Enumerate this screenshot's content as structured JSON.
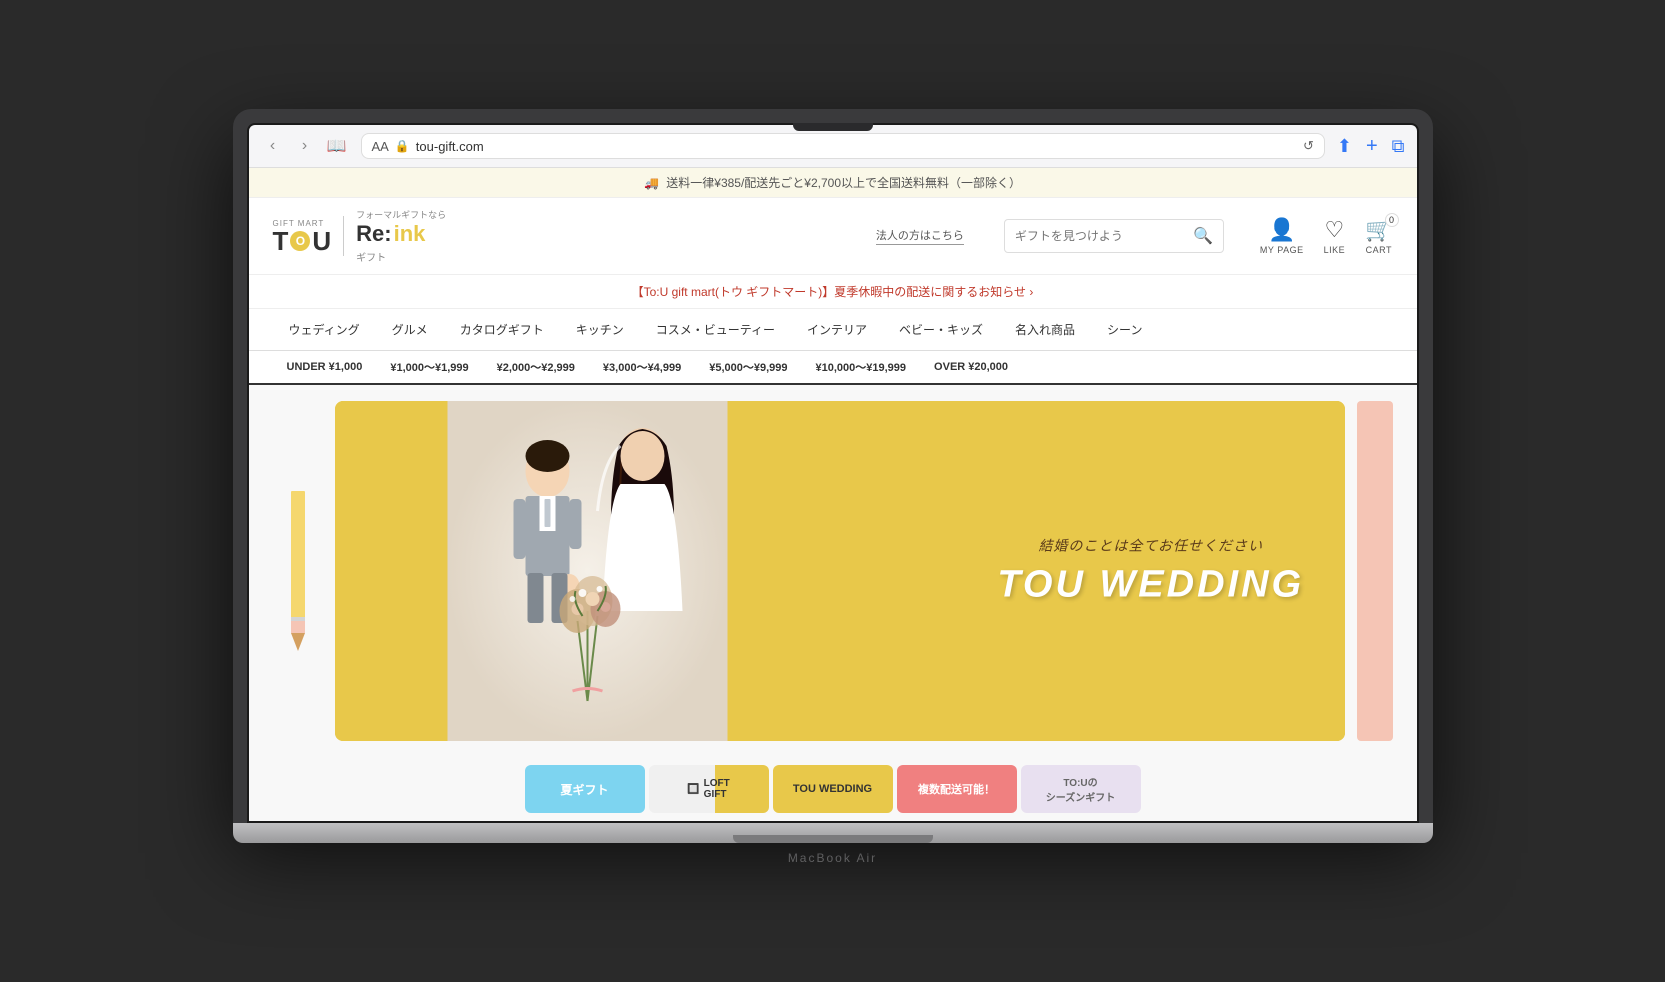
{
  "laptop": {
    "model": "MacBook Air"
  },
  "browser": {
    "back_label": "‹",
    "forward_label": "›",
    "bookmarks_icon": "📖",
    "aa_label": "AA",
    "url": "tou-gift.com",
    "reload_icon": "↺",
    "share_icon": "⬆",
    "new_tab_icon": "+",
    "tabs_icon": "⧉"
  },
  "announcement": {
    "text": "送料一律¥385/配送先ごと¥2,700以上で全国送料無料（一部除く）"
  },
  "header": {
    "gift_mart_label": "GIFT MART",
    "logo_text": "TOU",
    "re_ink_sub": "フォーマルギフトなら",
    "re_ink_main": "Re:ink",
    "re_ink_note": "ギフト",
    "corporate_link": "法人の方はこちら",
    "search_placeholder": "ギフトを見つけよう",
    "my_page_label": "MY PAGE",
    "like_label": "LIKE",
    "cart_label": "CART",
    "cart_count": "0"
  },
  "notification": {
    "text": "【To:U gift mart(トウ ギフトマート)】夏季休暇中の配送に関するお知らせ ›"
  },
  "main_nav": {
    "items": [
      {
        "label": "ウェディング"
      },
      {
        "label": "グルメ"
      },
      {
        "label": "カタログギフト"
      },
      {
        "label": "キッチン"
      },
      {
        "label": "コスメ・ビューティー"
      },
      {
        "label": "インテリア"
      },
      {
        "label": "ベビー・キッズ"
      },
      {
        "label": "名入れ商品"
      },
      {
        "label": "シーン"
      }
    ]
  },
  "price_nav": {
    "items": [
      {
        "label": "UNDER ¥1,000"
      },
      {
        "label": "¥1,000〜¥1,999"
      },
      {
        "label": "¥2,000〜¥2,999"
      },
      {
        "label": "¥3,000〜¥4,999"
      },
      {
        "label": "¥5,000〜¥9,999"
      },
      {
        "label": "¥10,000〜¥19,999"
      },
      {
        "label": "OVER ¥20,000"
      }
    ]
  },
  "hero": {
    "subtitle": "結婚のことは全てお任せください",
    "title": "TOU WEDDING"
  },
  "thumbnails": [
    {
      "label": "夏ギフト",
      "style": "natsu"
    },
    {
      "label": "LOFT GIFT",
      "style": "loft"
    },
    {
      "label": "TOU WEDDING",
      "style": "tou-wedding"
    },
    {
      "label": "複数配送可能！",
      "style": "fukusu"
    },
    {
      "label": "TO:Uの シーズンギフト",
      "style": "season"
    }
  ],
  "colors": {
    "accent_yellow": "#e8c84a",
    "brand_red": "#c0392b",
    "link_blue": "#3478f6"
  }
}
